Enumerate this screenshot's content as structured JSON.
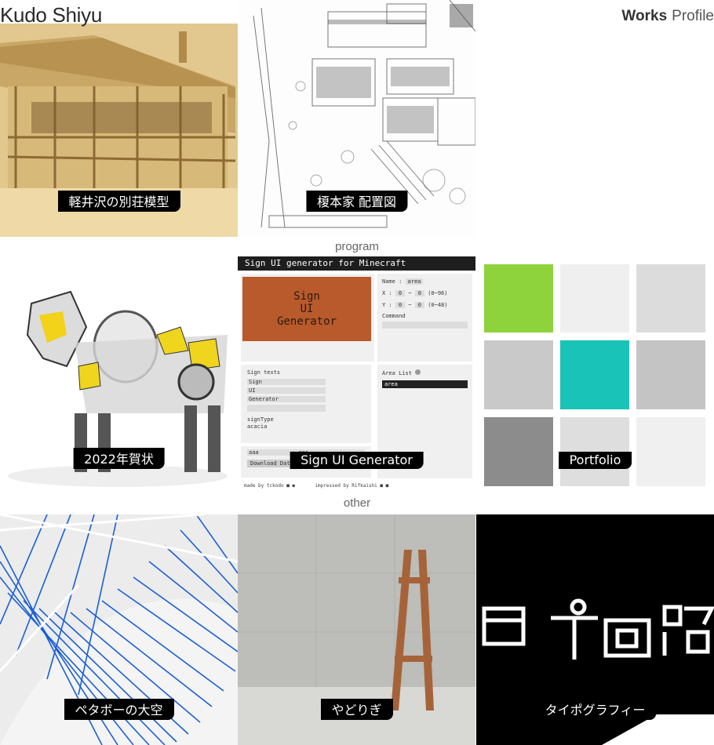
{
  "site": {
    "title": "Kudo Shiyu"
  },
  "nav": {
    "works": "Works",
    "profile": "Profile"
  },
  "sections": {
    "program": "program",
    "other": "other"
  },
  "tiles": [
    {
      "caption": "軽井沢の別荘模型"
    },
    {
      "caption": "榎本家 配置図"
    },
    {
      "caption": "2022年賀状"
    },
    {
      "caption": "Sign UI Generator"
    },
    {
      "caption": "Portfolio"
    },
    {
      "caption": "ペタボーの大空"
    },
    {
      "caption": "やどりぎ"
    },
    {
      "caption": "タイポグラフィー"
    }
  ],
  "signui": {
    "title": "Sign UI generator for Minecraft",
    "sign_lines": [
      "Sign",
      "UI",
      "Generator"
    ],
    "name_label": "Name :",
    "name_value": "area",
    "x_label": "X :",
    "y_label": "Y :",
    "x_range": "(0~96)",
    "y_range": "(0~48)",
    "command_label": "Command",
    "sign_texts_label": "Sign texts",
    "sign_texts": [
      "Sign",
      "UI",
      "Generator"
    ],
    "sign_type_label": "signType",
    "sign_type_value": "acacia",
    "area_list_label": "Area List",
    "area_item": "area",
    "bottom_left": "aaa",
    "bottom_right": ": aaa",
    "download_label": "Download Datapack",
    "made_by": "made by tckodo",
    "impressed_by": "impressed by Rifkaishi"
  },
  "typography": {
    "chars": [
      "電",
      "子",
      "回",
      "路"
    ]
  },
  "colors": {
    "green": "#8fd33c",
    "teal": "#19c3b8",
    "gray_dark": "#8c8c8c"
  }
}
